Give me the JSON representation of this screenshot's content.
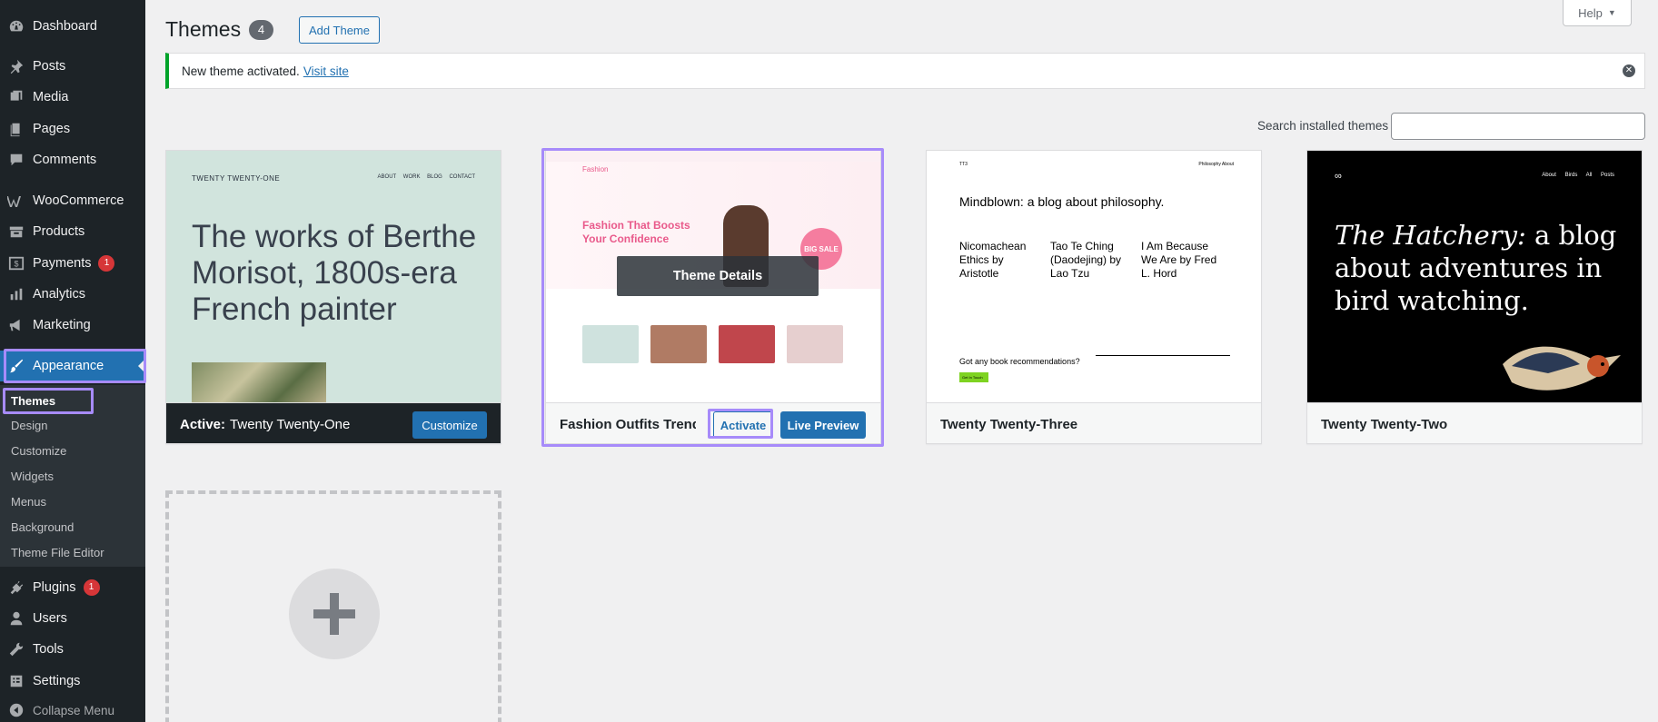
{
  "sidebar": {
    "items": [
      {
        "label": "Dashboard",
        "icon": "dashboard-icon"
      },
      {
        "label": "Posts",
        "icon": "pin-icon"
      },
      {
        "label": "Media",
        "icon": "media-icon"
      },
      {
        "label": "Pages",
        "icon": "pages-icon"
      },
      {
        "label": "Comments",
        "icon": "comment-icon"
      },
      {
        "label": "WooCommerce",
        "icon": "woo-icon"
      },
      {
        "label": "Products",
        "icon": "archive-icon"
      },
      {
        "label": "Payments",
        "icon": "dollar-icon",
        "badge": "1"
      },
      {
        "label": "Analytics",
        "icon": "chart-bar-icon"
      },
      {
        "label": "Marketing",
        "icon": "megaphone-icon"
      },
      {
        "label": "Appearance",
        "icon": "brush-icon"
      },
      {
        "label": "Plugins",
        "icon": "plugin-icon",
        "badge": "1"
      },
      {
        "label": "Users",
        "icon": "user-icon"
      },
      {
        "label": "Tools",
        "icon": "wrench-icon"
      },
      {
        "label": "Settings",
        "icon": "settings-icon"
      },
      {
        "label": "Collapse Menu",
        "icon": "collapse-icon"
      }
    ],
    "submenu": [
      "Themes",
      "Design",
      "Customize",
      "Widgets",
      "Menus",
      "Background",
      "Theme File Editor"
    ]
  },
  "header": {
    "title": "Themes",
    "count": "4",
    "add_button": "Add Theme",
    "help": "Help"
  },
  "notice": {
    "text": "New theme activated.",
    "link": "Visit site"
  },
  "search": {
    "label": "Search installed themes",
    "value": ""
  },
  "themes": [
    {
      "active_prefix": "Active:",
      "name": "Twenty Twenty-One",
      "action": "Customize",
      "preview": {
        "brand": "TWENTY TWENTY-ONE",
        "nav": "ABOUT WORK BLOG CONTACT",
        "hero": "The works of Berthe Morisot, 1800s-era French painter"
      }
    },
    {
      "name": "Fashion Outfits Trend",
      "actions": [
        "Activate",
        "Live Preview"
      ],
      "overlay": "Theme Details",
      "preview": {
        "logo": "Fashion",
        "headline": "Fashion That Boosts Your Confidence",
        "sale": "BIG SALE"
      }
    },
    {
      "name": "Twenty Twenty-Three",
      "preview": {
        "brand": "TT3",
        "nav": "Philosophy About",
        "headline": "Mindblown: a blog about philosophy.",
        "posts": [
          "Nicomachean Ethics by Aristotle",
          "Tao Te Ching (Daodejing) by Lao Tzu",
          "I Am Because We Are by Fred L. Hord"
        ],
        "cta": "Got any book recommendations?",
        "cta_button": "Get In Touch"
      }
    },
    {
      "name": "Twenty Twenty-Two",
      "preview": {
        "hero_em": "The Hatchery:",
        "hero": "a blog about adventures in bird watching.",
        "nav": "About Birds All Posts"
      }
    }
  ],
  "colors": {
    "sidebar_bg": "#1d2327",
    "accent": "#2271b1",
    "badge": "#d63638",
    "notice_success": "#00a32a",
    "highlight": "#a78bfa"
  }
}
